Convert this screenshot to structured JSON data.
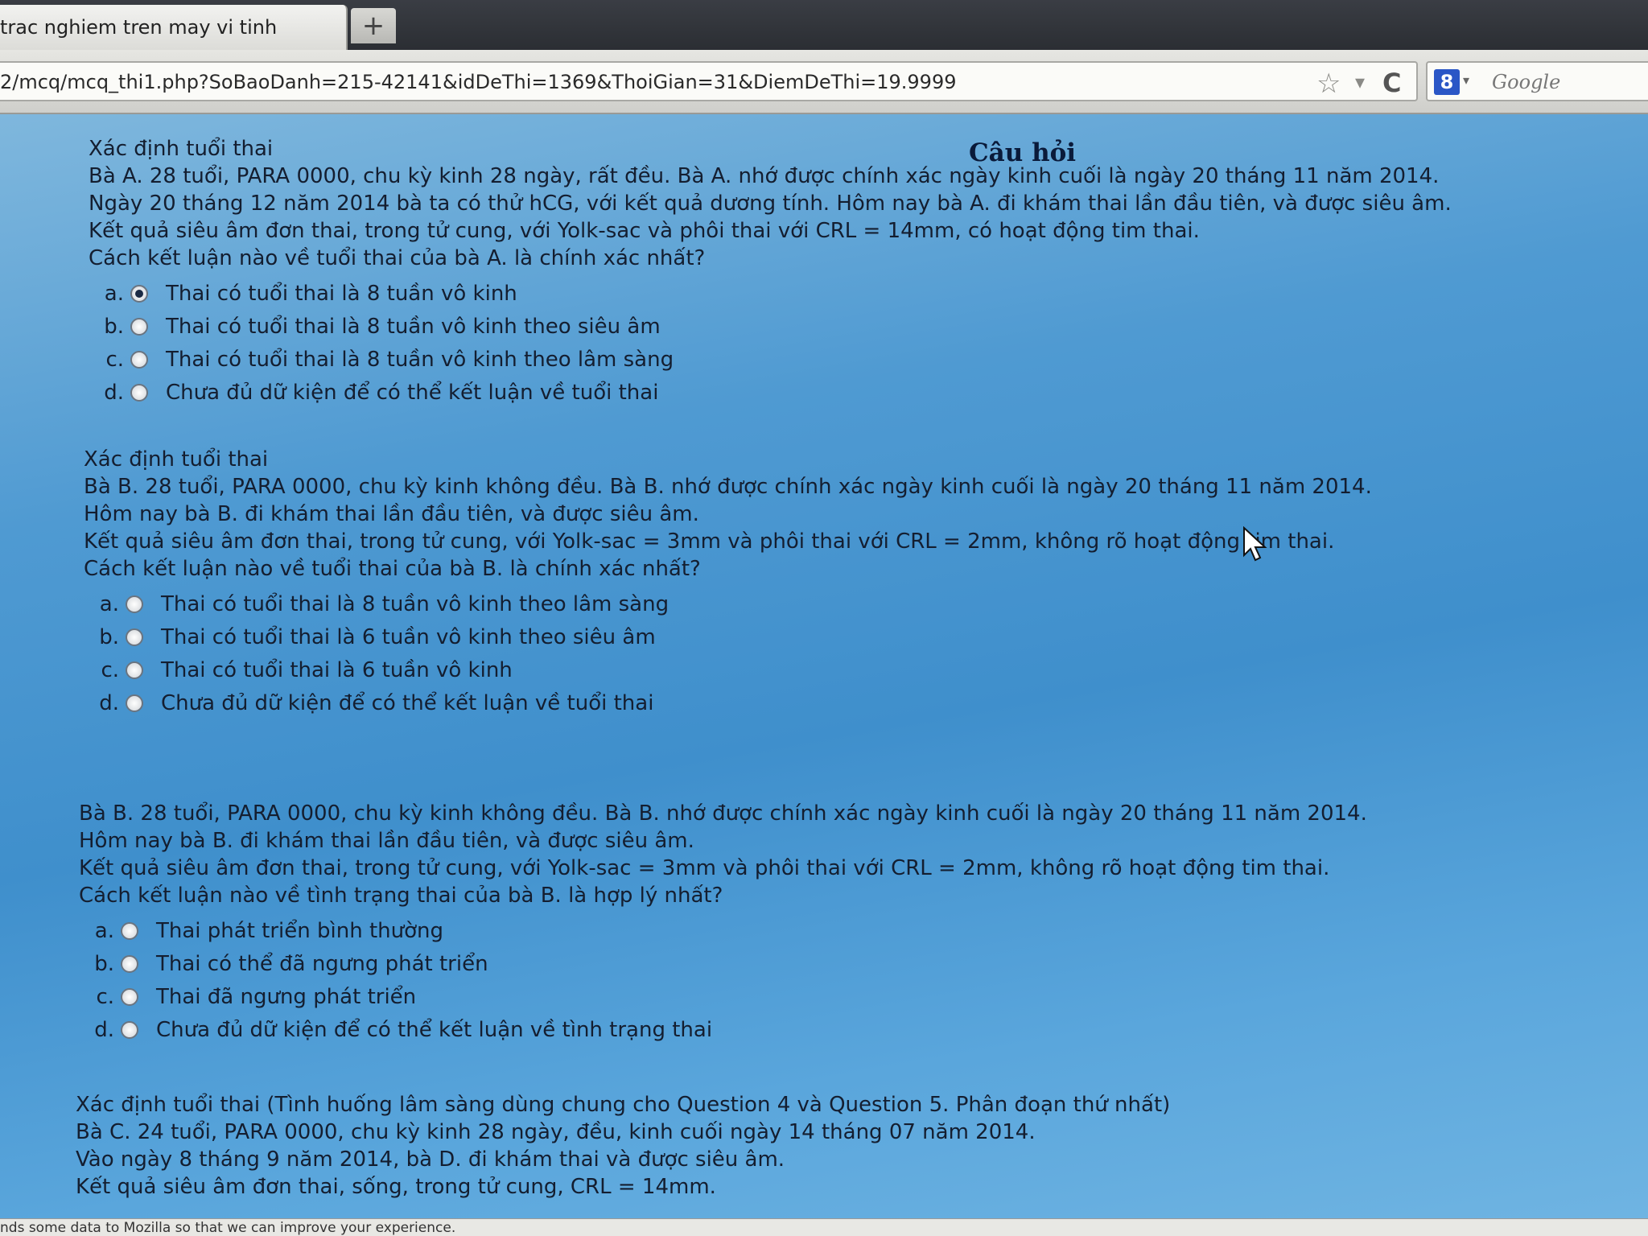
{
  "browser": {
    "tab_title": "trac nghiem tren may vi tinh",
    "new_tab_label": "+",
    "url": "2/mcq/mcq_thi1.php?SoBaoDanh=215-42141&idDeThi=1369&ThoiGian=31&DiemDeThi=19.9999",
    "star_glyph": "☆",
    "dropmarker_glyph": "▾",
    "reload_glyph": "C",
    "search_engine_glyph": "8",
    "search_placeholder": "Google",
    "status_text": "nds some data to Mozilla so that we can improve your experience.",
    "accent_color": "#2a56c6"
  },
  "page": {
    "heading": "Câu hỏi"
  },
  "questions": [
    {
      "lines": [
        "Xác định tuổi thai",
        "Bà A. 28 tuổi, PARA 0000, chu kỳ kinh 28 ngày, rất đều. Bà A. nhớ được chính xác ngày kinh cuối là ngày 20 tháng 11 năm 2014.",
        "Ngày 20 tháng 12 năm 2014 bà ta có thử hCG, với kết quả dương tính. Hôm nay bà A. đi khám thai lần đầu tiên, và được siêu âm.",
        "Kết quả siêu âm đơn thai, trong tử cung, với Yolk-sac và phôi thai với CRL = 14mm, có hoạt động tim thai.",
        "Cách kết luận nào về tuổi thai của bà A. là chính xác nhất?"
      ],
      "options": [
        {
          "letter": "a.",
          "text": "Thai có tuổi thai là 8 tuần vô kinh",
          "checked": true
        },
        {
          "letter": "b.",
          "text": "Thai có tuổi thai là 8 tuần vô kinh theo siêu âm",
          "checked": false
        },
        {
          "letter": "c.",
          "text": "Thai có tuổi thai là 8 tuần vô kinh theo lâm sàng",
          "checked": false
        },
        {
          "letter": "d.",
          "text": "Chưa đủ dữ kiện để có thể kết luận về tuổi thai",
          "checked": false
        }
      ]
    },
    {
      "lines": [
        "Xác định tuổi thai",
        "Bà B. 28 tuổi, PARA 0000, chu kỳ kinh không đều. Bà B. nhớ được chính xác ngày kinh cuối là ngày 20 tháng 11 năm 2014.",
        "Hôm nay bà B. đi khám thai lần đầu tiên, và được siêu âm.",
        "Kết quả siêu âm đơn thai, trong tử cung, với Yolk-sac = 3mm và phôi thai với CRL = 2mm, không rõ hoạt động tim thai.",
        "Cách kết luận nào về tuổi thai của bà B. là chính xác nhất?"
      ],
      "options": [
        {
          "letter": "a.",
          "text": "Thai có tuổi thai là 8 tuần vô kinh theo lâm sàng",
          "checked": false
        },
        {
          "letter": "b.",
          "text": "Thai có tuổi thai là 6 tuần vô kinh theo siêu âm",
          "checked": false
        },
        {
          "letter": "c.",
          "text": "Thai có tuổi thai là 6 tuần vô kinh",
          "checked": false
        },
        {
          "letter": "d.",
          "text": "Chưa đủ dữ kiện để có thể kết luận về tuổi thai",
          "checked": false
        }
      ]
    },
    {
      "lines": [
        "Bà B. 28 tuổi, PARA 0000, chu kỳ kinh không đều. Bà B. nhớ được chính xác ngày kinh cuối là ngày 20 tháng 11 năm 2014.",
        "Hôm nay bà B. đi khám thai lần đầu tiên, và được siêu âm.",
        "Kết quả siêu âm đơn thai, trong tử cung, với Yolk-sac = 3mm và phôi thai với CRL = 2mm, không rõ hoạt động tim thai.",
        "Cách kết luận nào về tình trạng thai của bà B. là hợp lý nhất?"
      ],
      "options": [
        {
          "letter": "a.",
          "text": "Thai phát triển bình thường",
          "checked": false
        },
        {
          "letter": "b.",
          "text": "Thai có thể đã ngưng phát triển",
          "checked": false
        },
        {
          "letter": "c.",
          "text": "Thai đã ngưng phát triển",
          "checked": false
        },
        {
          "letter": "d.",
          "text": "Chưa đủ dữ kiện để có thể kết luận về tình trạng thai",
          "checked": false
        }
      ]
    },
    {
      "lines": [
        "Xác định tuổi thai (Tình huống lâm sàng dùng chung cho Question 4 và Question 5. Phân đoạn thứ nhất)",
        "Bà C. 24 tuổi, PARA 0000, chu kỳ kinh 28 ngày, đều, kinh cuối ngày 14 tháng 07 năm 2014.",
        "Vào ngày 8 tháng 9 năm 2014, bà D. đi khám thai và được siêu âm.",
        "Kết quả siêu âm đơn thai, sống, trong tử cung, CRL = 14mm."
      ],
      "options": []
    }
  ]
}
